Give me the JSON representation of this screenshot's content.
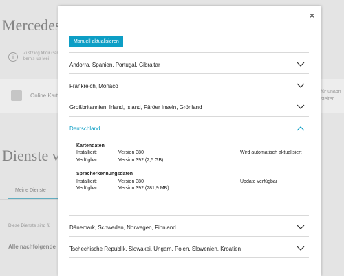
{
  "background": {
    "title": "Mercedes m",
    "info_text": "Zustzlicg fdfdir Ganz bernis ius Mei",
    "card_label": "Online Karte",
    "right_card_text": "für unabn steiter",
    "section_title": "Dienste ve",
    "tab_label": "Meine Dienste",
    "line_1": "Diese Dienste sind fü",
    "line_2": "Alle nachfolgende"
  },
  "modal": {
    "close_icon": "×",
    "update_button": "Manuell aktualisieren",
    "regions_top": [
      {
        "label": "Andorra, Spanien, Portugal, Gibraltar"
      },
      {
        "label": "Frankreich, Monaco"
      },
      {
        "label": "Großbritannien, Irland, Island, Färöer Inseln, Grönland"
      }
    ],
    "expanded": {
      "label": "Deutschland",
      "sections": [
        {
          "title": "Kartendaten",
          "rows": [
            {
              "label": "Installiert:",
              "value": "Version 380",
              "status": "Wird automatisch aktualisiert"
            },
            {
              "label": "Verfügbar:",
              "value": "Version 392 (2,5 GB)",
              "status": ""
            }
          ]
        },
        {
          "title": "Spracherkennungsdaten",
          "rows": [
            {
              "label": "Installiert:",
              "value": "Version 380",
              "status": "Update verfügbar"
            },
            {
              "label": "Verfügbar:",
              "value": "Version 392 (281,9 MB)",
              "status": ""
            }
          ]
        }
      ]
    },
    "regions_bottom": [
      {
        "label": "Dänemark, Schweden, Norwegen, Finnland"
      },
      {
        "label": "Tschechische Republik, Slowakei, Ungarn, Polen, Slowenien, Kroatien"
      }
    ],
    "colors": {
      "accent": "#0d9ec5",
      "divider": "#d9d9d9"
    },
    "icons": {
      "collapsed": "chevron-down-icon",
      "expanded": "chevron-up-icon"
    }
  }
}
